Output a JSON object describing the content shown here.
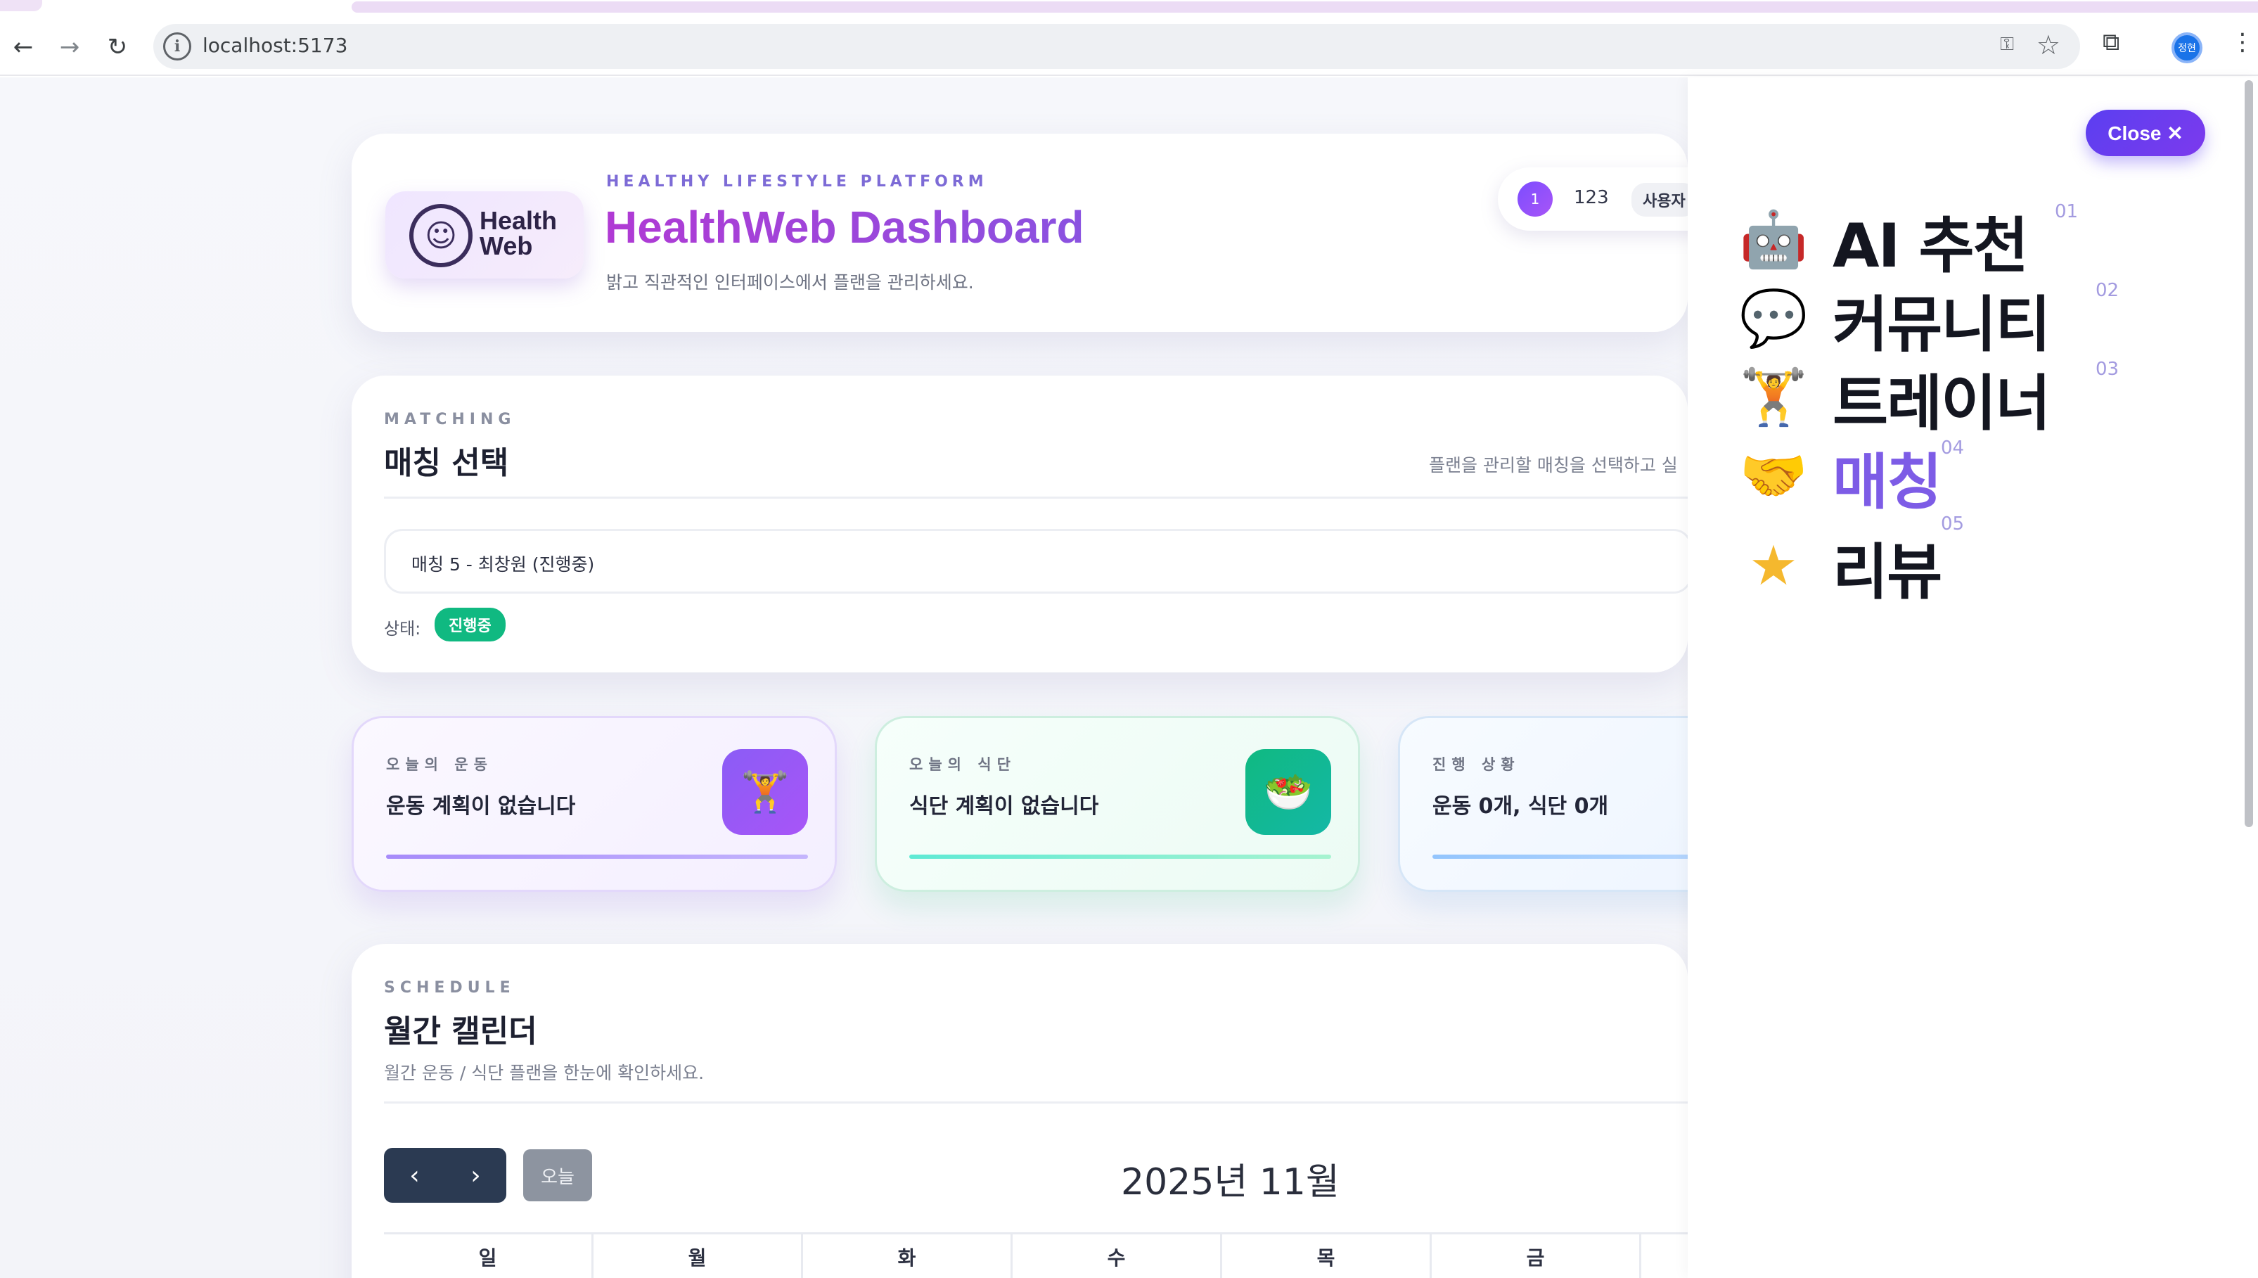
{
  "browser": {
    "url": "localhost:5173",
    "back_icon": "arrow-left-icon",
    "forward_icon": "arrow-right-icon",
    "reload_icon": "reload-icon",
    "profile_initials": "정현"
  },
  "header": {
    "kicker": "HEALTHY LIFESTYLE PLATFORM",
    "title": "HealthWeb Dashboard",
    "subtitle": "밝고 직관적인 인터페이스에서 플랜을 관리하세요.",
    "logo_line1": "Health",
    "logo_line2": "Web",
    "user_number": "1",
    "user_id": "123",
    "user_role": "사용자"
  },
  "matching": {
    "kicker": "MATCHING",
    "title": "매칭 선택",
    "help": "플랜을 관리할 매칭을 선택하고 실",
    "selected": "매칭 5 - 최창원 (진행중)",
    "status_label": "상태:",
    "status_value": "진행중",
    "status_color": "#10b981"
  },
  "stats": [
    {
      "kicker": "오늘의 운동",
      "value": "운동 계획이 없습니다",
      "icon": "weightlifter-icon"
    },
    {
      "kicker": "오늘의 식단",
      "value": "식단 계획이 없습니다",
      "icon": "salad-bowl-icon"
    },
    {
      "kicker": "진행 상황",
      "value": "운동 0개, 식단 0개"
    }
  ],
  "schedule": {
    "kicker": "SCHEDULE",
    "title": "월간 캘린더",
    "subtitle": "월간 운동 / 식단 플랜을 한눈에 확인하세요.",
    "today_label": "오늘",
    "month_label": "2025년 11월",
    "weekdays": [
      "일",
      "월",
      "화",
      "수",
      "목",
      "금"
    ]
  },
  "panel": {
    "close_label": "Close ✕",
    "accent_color": "#7d5ce6",
    "items": [
      {
        "label": "AI 추천",
        "num": "01",
        "icon": "robot-icon"
      },
      {
        "label": "커뮤니티",
        "num": "02",
        "icon": "speech-bubble-icon"
      },
      {
        "label": "트레이너",
        "num": "03",
        "icon": "trainer-icon"
      },
      {
        "label": "매칭",
        "num": "04",
        "icon": "handshake-icon",
        "active": true
      },
      {
        "label": "리뷰",
        "num": "05",
        "icon": "star-icon"
      }
    ]
  }
}
